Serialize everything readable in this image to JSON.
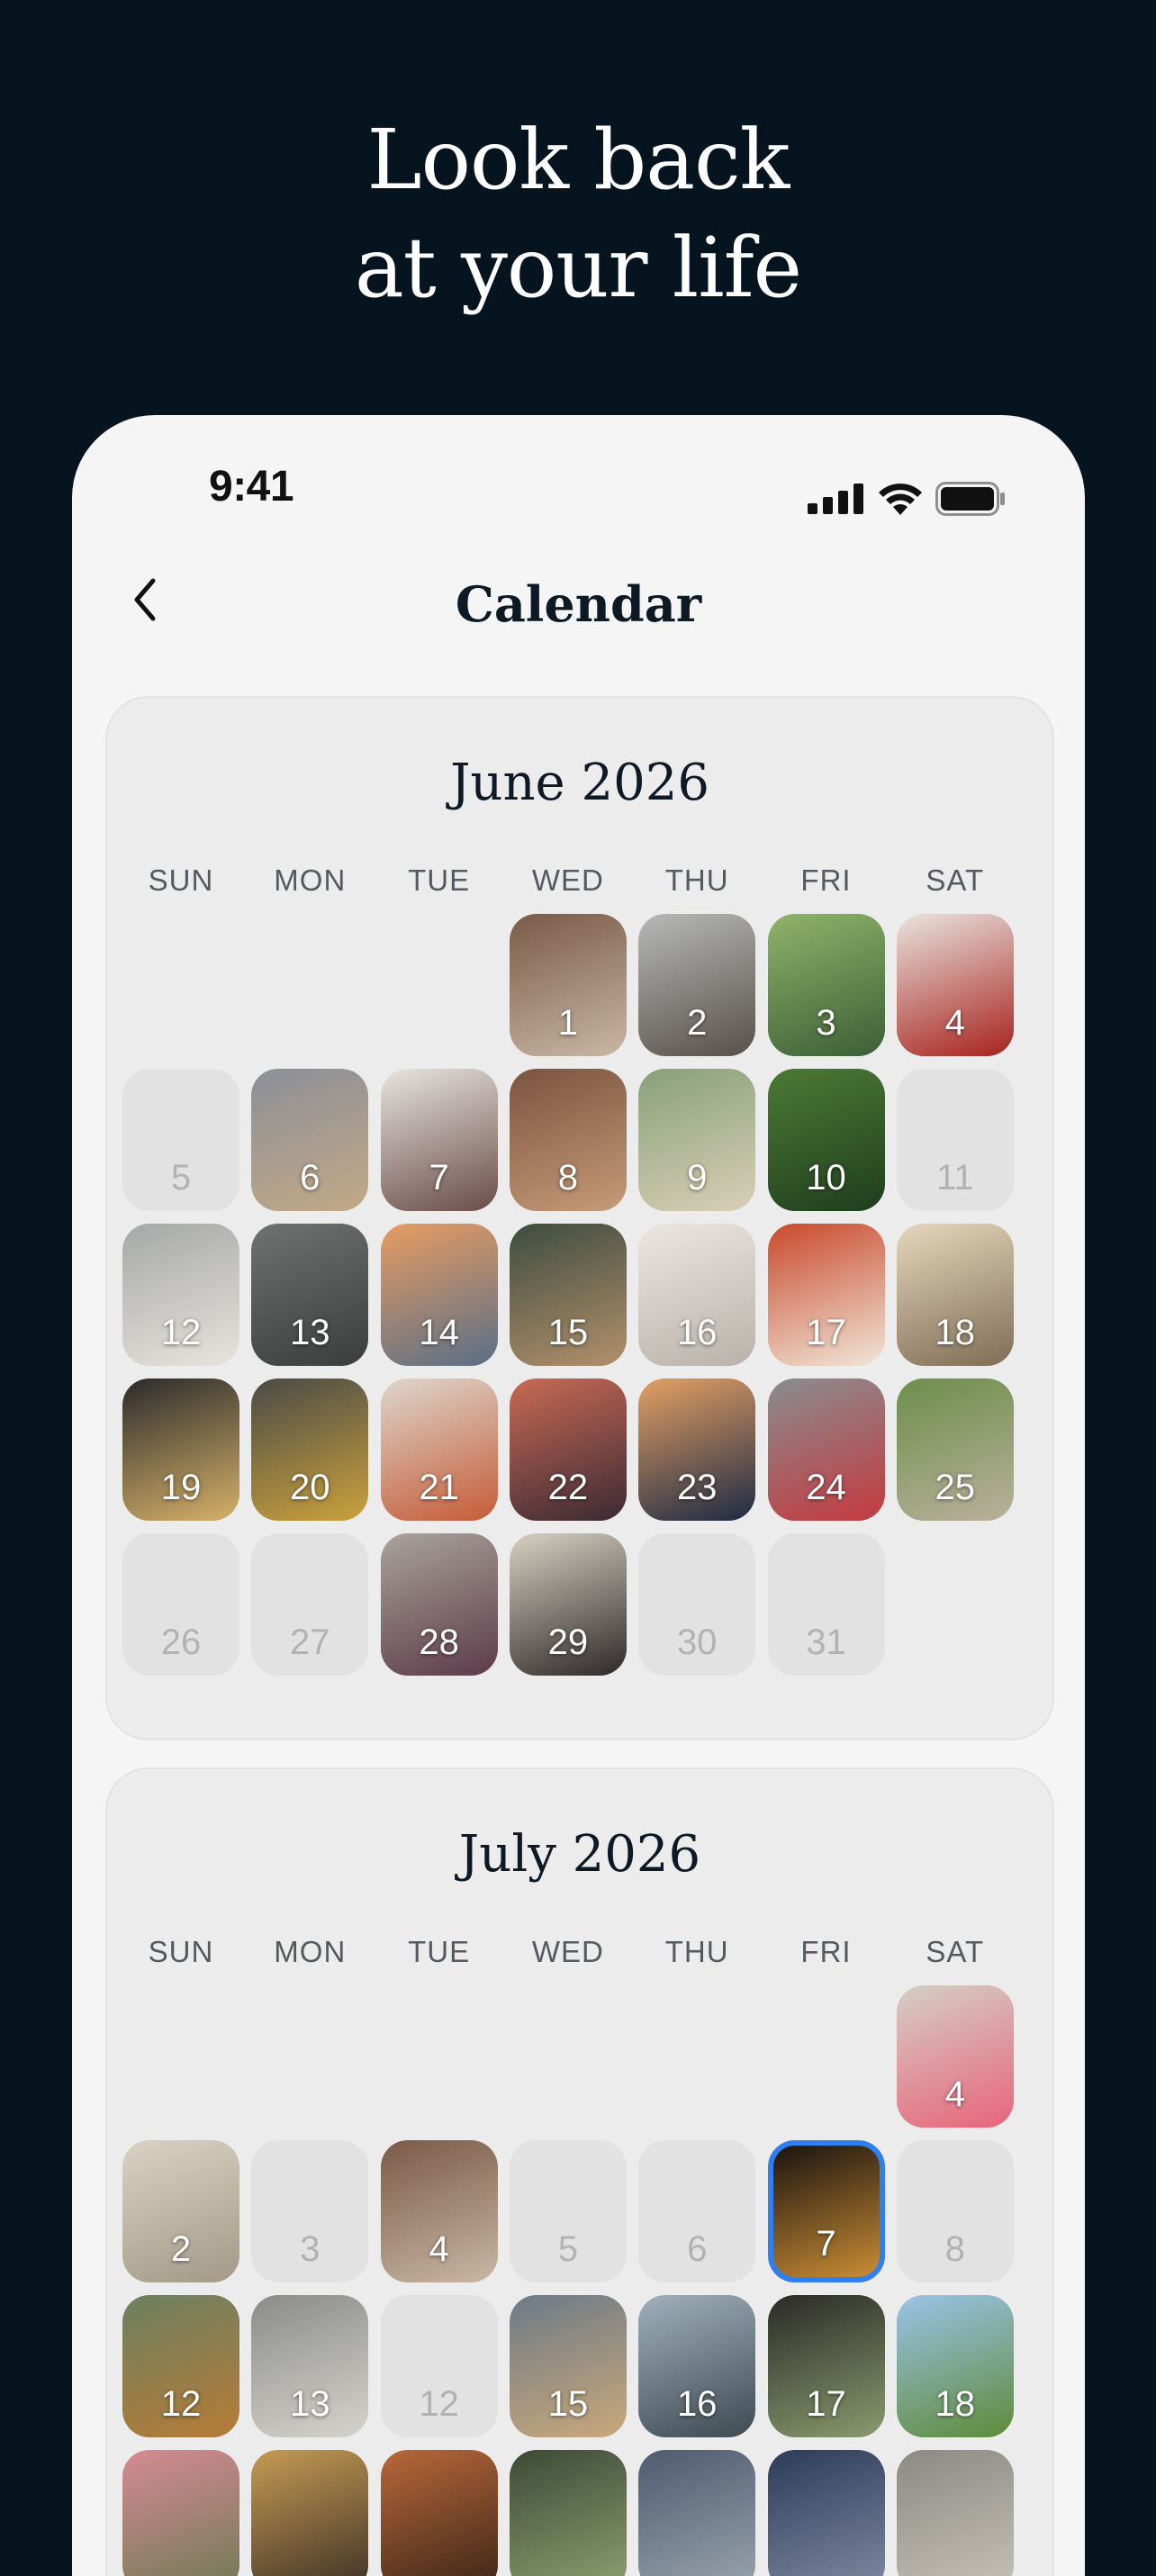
{
  "headline": {
    "line1": "Look back",
    "line2": "at your life"
  },
  "status_bar": {
    "time": "9:41"
  },
  "nav": {
    "title": "Calendar"
  },
  "weekdays": [
    "SUN",
    "MON",
    "TUE",
    "WED",
    "THU",
    "FRI",
    "SAT"
  ],
  "months": [
    {
      "title": "June 2026",
      "first_weekday": 3,
      "days": [
        {
          "n": "1",
          "photo": true,
          "colors": [
            "#7a5a48",
            "#c9b7a4"
          ]
        },
        {
          "n": "2",
          "photo": true,
          "colors": [
            "#b7b9b7",
            "#57504b"
          ]
        },
        {
          "n": "3",
          "photo": true,
          "colors": [
            "#8fb46a",
            "#3c5e36"
          ]
        },
        {
          "n": "4",
          "photo": true,
          "colors": [
            "#e9e4de",
            "#a8221e"
          ]
        },
        {
          "n": "5",
          "photo": false
        },
        {
          "n": "6",
          "photo": true,
          "colors": [
            "#8b8f98",
            "#c3a986"
          ]
        },
        {
          "n": "7",
          "photo": true,
          "colors": [
            "#e7e4e0",
            "#6a4c48"
          ]
        },
        {
          "n": "8",
          "photo": true,
          "colors": [
            "#7b5440",
            "#c59b77"
          ]
        },
        {
          "n": "9",
          "photo": true,
          "colors": [
            "#88a07a",
            "#d9cfb6"
          ]
        },
        {
          "n": "10",
          "photo": true,
          "colors": [
            "#4d7a35",
            "#1f3d1d"
          ]
        },
        {
          "n": "11",
          "photo": false
        },
        {
          "n": "12",
          "photo": true,
          "colors": [
            "#a5a8a7",
            "#e8e3dd"
          ]
        },
        {
          "n": "13",
          "photo": true,
          "colors": [
            "#6e7270",
            "#3b3d3c"
          ]
        },
        {
          "n": "14",
          "photo": true,
          "colors": [
            "#e79c63",
            "#5a6f86"
          ]
        },
        {
          "n": "15",
          "photo": true,
          "colors": [
            "#3e4c3f",
            "#b2906b"
          ]
        },
        {
          "n": "16",
          "photo": true,
          "colors": [
            "#ebe6e0",
            "#b8b2aa"
          ]
        },
        {
          "n": "17",
          "photo": true,
          "colors": [
            "#c9492d",
            "#f0e6d8"
          ]
        },
        {
          "n": "18",
          "photo": true,
          "colors": [
            "#e5d7bd",
            "#7f6d55"
          ]
        },
        {
          "n": "19",
          "photo": true,
          "colors": [
            "#2b2b2b",
            "#d6b169"
          ]
        },
        {
          "n": "20",
          "photo": true,
          "colors": [
            "#4a4a46",
            "#caa23d"
          ]
        },
        {
          "n": "21",
          "photo": true,
          "colors": [
            "#ddd6cc",
            "#c55b37"
          ]
        },
        {
          "n": "22",
          "photo": true,
          "colors": [
            "#c86a55",
            "#3b2a34"
          ]
        },
        {
          "n": "23",
          "photo": true,
          "colors": [
            "#e3a064",
            "#1e2a44"
          ]
        },
        {
          "n": "24",
          "photo": true,
          "colors": [
            "#8a8c90",
            "#c43a3f"
          ]
        },
        {
          "n": "25",
          "photo": true,
          "colors": [
            "#6d8e4a",
            "#b9b09c"
          ]
        },
        {
          "n": "26",
          "photo": false
        },
        {
          "n": "27",
          "photo": false
        },
        {
          "n": "28",
          "photo": true,
          "colors": [
            "#a9a39a",
            "#5d3b4a"
          ]
        },
        {
          "n": "29",
          "photo": true,
          "colors": [
            "#d8d0c2",
            "#2e2a2a"
          ]
        },
        {
          "n": "30",
          "photo": false
        },
        {
          "n": "31",
          "photo": false
        }
      ]
    },
    {
      "title": "July 2026",
      "first_weekday": 6,
      "days": [
        {
          "n": "4",
          "photo": true,
          "colors": [
            "#d4cfc6",
            "#e8647a"
          ]
        },
        {
          "n": "2",
          "photo": true,
          "colors": [
            "#d9d2c4",
            "#a39987"
          ]
        },
        {
          "n": "3",
          "photo": false
        },
        {
          "n": "4",
          "photo": true,
          "colors": [
            "#7a5a48",
            "#c9b7a4"
          ]
        },
        {
          "n": "5",
          "photo": false
        },
        {
          "n": "6",
          "photo": false
        },
        {
          "n": "7",
          "photo": true,
          "selected": true,
          "colors": [
            "#1a1410",
            "#c98c34"
          ]
        },
        {
          "n": "8",
          "photo": false
        },
        {
          "n": "12",
          "photo": true,
          "colors": [
            "#6c8061",
            "#b67b36"
          ]
        },
        {
          "n": "13",
          "photo": true,
          "colors": [
            "#8a8c8a",
            "#d6d3cd"
          ]
        },
        {
          "n": "12",
          "photo": false
        },
        {
          "n": "15",
          "photo": true,
          "colors": [
            "#6d7a87",
            "#c9a87a"
          ]
        },
        {
          "n": "16",
          "photo": true,
          "colors": [
            "#9fb0bc",
            "#3f4a52"
          ]
        },
        {
          "n": "17",
          "photo": true,
          "colors": [
            "#2a2a26",
            "#8a9a6e"
          ]
        },
        {
          "n": "18",
          "photo": true,
          "colors": [
            "#9ac3e8",
            "#5f8a38"
          ]
        }
      ],
      "next_row_preview": [
        {
          "colors": [
            "#d58a93",
            "#6f7a55"
          ]
        },
        {
          "colors": [
            "#c59b55",
            "#3e3126"
          ]
        },
        {
          "colors": [
            "#b8683a",
            "#3b2518"
          ]
        },
        {
          "colors": [
            "#3c4a36",
            "#8da070"
          ]
        },
        {
          "colors": [
            "#4e5b6e",
            "#9aa4ae"
          ]
        },
        {
          "colors": [
            "#2d3b58",
            "#7f8aa2"
          ]
        },
        {
          "colors": [
            "#8a8a84",
            "#c7c1b6"
          ]
        }
      ]
    }
  ]
}
